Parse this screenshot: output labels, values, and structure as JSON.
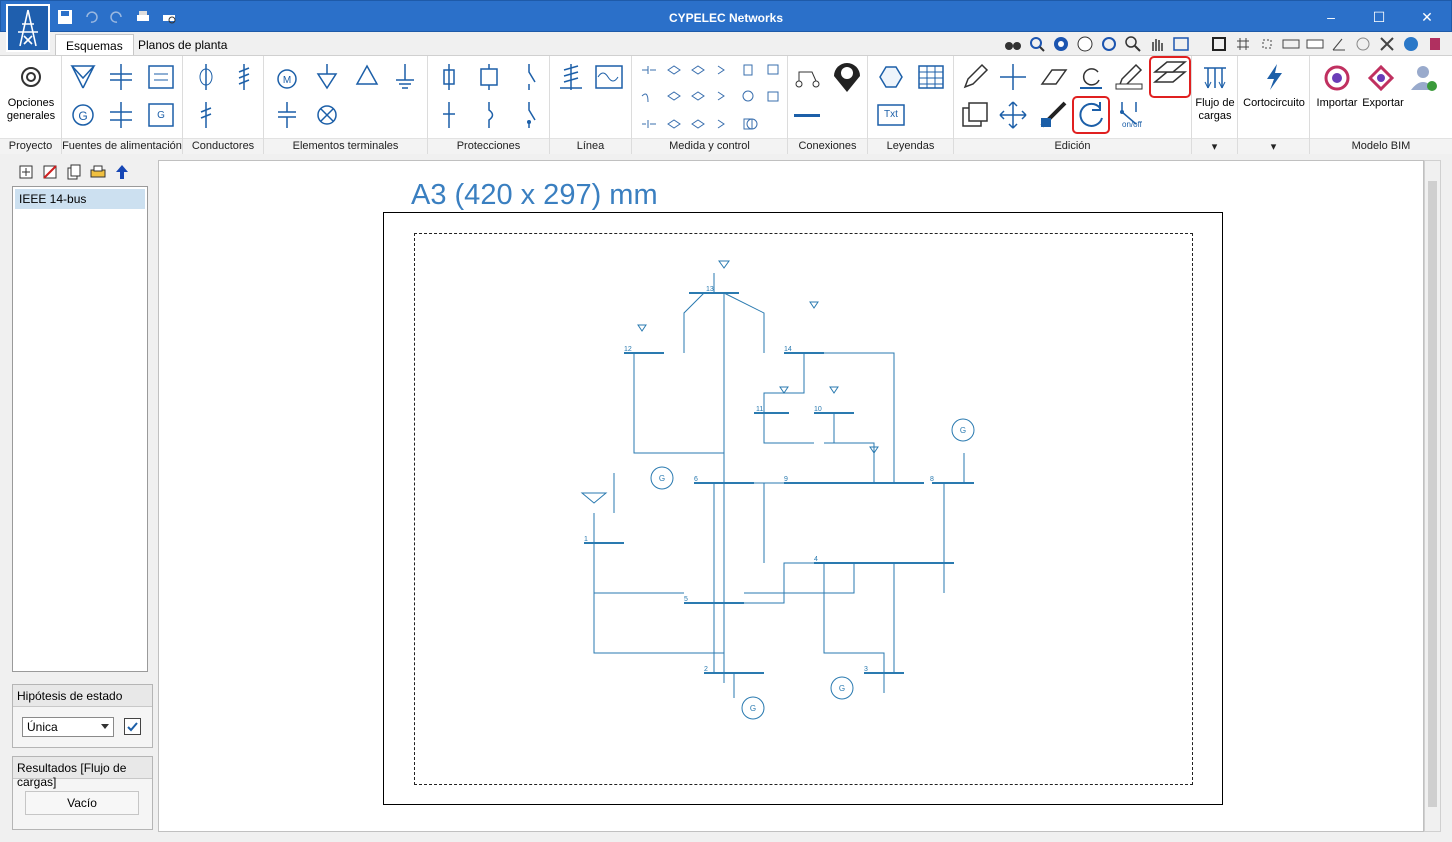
{
  "window": {
    "title": "CYPELEC Networks"
  },
  "tabs": [
    {
      "label": "Esquemas"
    },
    {
      "label": "Planos de planta"
    }
  ],
  "ribbon": {
    "groups": [
      {
        "label": "Proyecto"
      },
      {
        "label": "Fuentes de alimentación"
      },
      {
        "label": "Conductores"
      },
      {
        "label": "Elementos terminales"
      },
      {
        "label": "Protecciones"
      },
      {
        "label": "Línea"
      },
      {
        "label": "Medida y control"
      },
      {
        "label": "Conexiones"
      },
      {
        "label": "Leyendas"
      },
      {
        "label": "Edición"
      },
      {
        "label": "Modelo BIM"
      }
    ],
    "buttons": {
      "opciones_generales": "Opciones generales",
      "flujo_de_cargas": "Flujo de cargas",
      "cortocircuito": "Cortocircuito",
      "importar": "Importar",
      "exportar": "Exportar",
      "txt": "Txt",
      "on_off": "on/off"
    }
  },
  "left_panel": {
    "tree_items": [
      {
        "label": "IEEE 14-bus"
      }
    ],
    "hipotesis": {
      "title": "Hipótesis de estado",
      "selected": "Única",
      "checked": true
    },
    "resultados": {
      "title": "Resultados [Flujo de cargas]",
      "button": "Vacío"
    }
  },
  "canvas": {
    "sheet_title": "A3 (420 x 297) mm",
    "buses": [
      "1",
      "2",
      "3",
      "4",
      "5",
      "6",
      "7",
      "8",
      "9",
      "10",
      "11",
      "12",
      "13",
      "14"
    ]
  },
  "colors": {
    "titlebar": "#2b70c9",
    "accent": "#3a7fc0",
    "schematic": "#2a7ab0",
    "highlight": "#e02020"
  }
}
